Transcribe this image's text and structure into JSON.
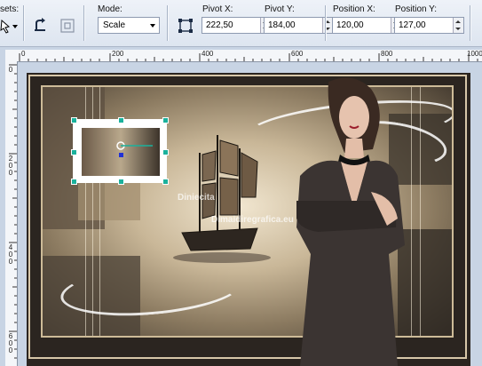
{
  "toolbar": {
    "presets_label": "sets:",
    "mode_label": "Mode:",
    "mode_value": "Scale",
    "pivot_x_label": "Pivot X:",
    "pivot_x_value": "222,50",
    "pivot_y_label": "Pivot Y:",
    "pivot_y_value": "184,00",
    "position_x_label": "Position X:",
    "position_x_value": "120,00",
    "position_y_label": "Position Y:",
    "position_y_value": "127,00"
  },
  "ruler": {
    "h_labels": [
      "0",
      "200",
      "400",
      "600",
      "800",
      "1000"
    ],
    "v_labels": [
      "0",
      "2\n0\n0",
      "4\n0\n0",
      "6\n0\n0"
    ]
  },
  "canvas": {
    "watermark_top": "Diniecita",
    "watermark_bottom": "Dimaidiregrafica.eu"
  },
  "icons": {
    "tool": "pick-tool-icon",
    "rotate": "rotate-object-icon",
    "merge": "merge-icon",
    "pivot": "pivot-icon"
  },
  "colors": {
    "handle": "#1bb19c",
    "toolbar_bg": "#dde5f0"
  }
}
